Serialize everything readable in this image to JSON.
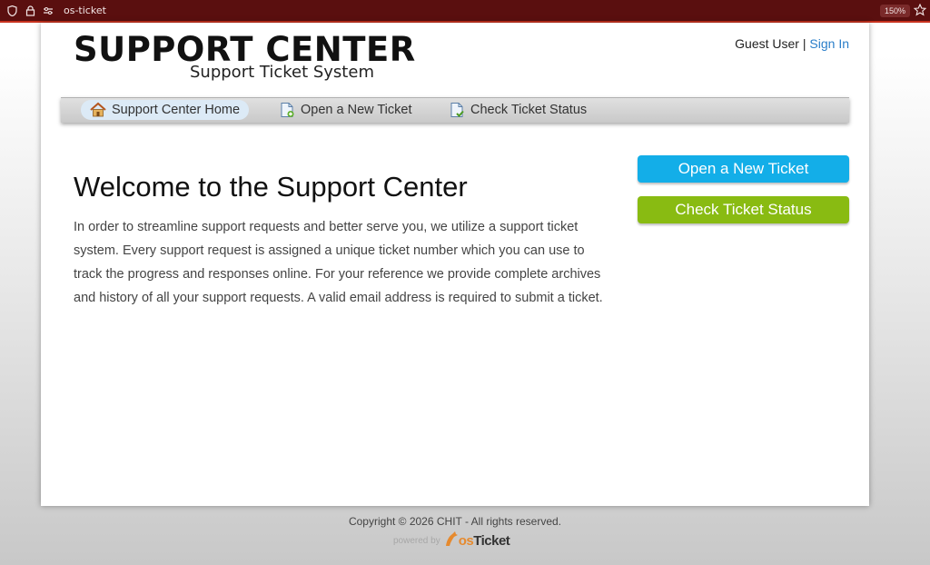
{
  "browser": {
    "url": "os-ticket",
    "zoom": "150%"
  },
  "header": {
    "logo_title": "SUPPORT CENTER",
    "logo_subtitle": "Support Ticket System",
    "guest_label": "Guest User",
    "separator": "|",
    "sign_in": "Sign In"
  },
  "nav": {
    "items": [
      {
        "label": "Support Center Home",
        "icon": "home-icon",
        "active": true
      },
      {
        "label": "Open a New Ticket",
        "icon": "new-ticket-icon",
        "active": false
      },
      {
        "label": "Check Ticket Status",
        "icon": "ticket-status-icon",
        "active": false
      }
    ]
  },
  "main": {
    "title": "Welcome to the Support Center",
    "intro": "In order to streamline support requests and better serve you, we utilize a support ticket system. Every support request is assigned a unique ticket number which you can use to track the progress and responses online. For your reference we provide complete archives and history of all your support requests. A valid email address is required to submit a ticket."
  },
  "sidebar": {
    "open_ticket": "Open a New Ticket",
    "check_status": "Check Ticket Status"
  },
  "footer": {
    "copyright": "Copyright © 2026 CHIT - All rights reserved.",
    "powered_by": "powered by",
    "brand_os": "os",
    "brand_ticket": "Ticket"
  },
  "colors": {
    "urlbar_bg": "#5a0f0f",
    "link": "#2a7ec9",
    "button_blue": "#13aee8",
    "button_green": "#89bb12",
    "nav_active": "#dceaf6"
  }
}
